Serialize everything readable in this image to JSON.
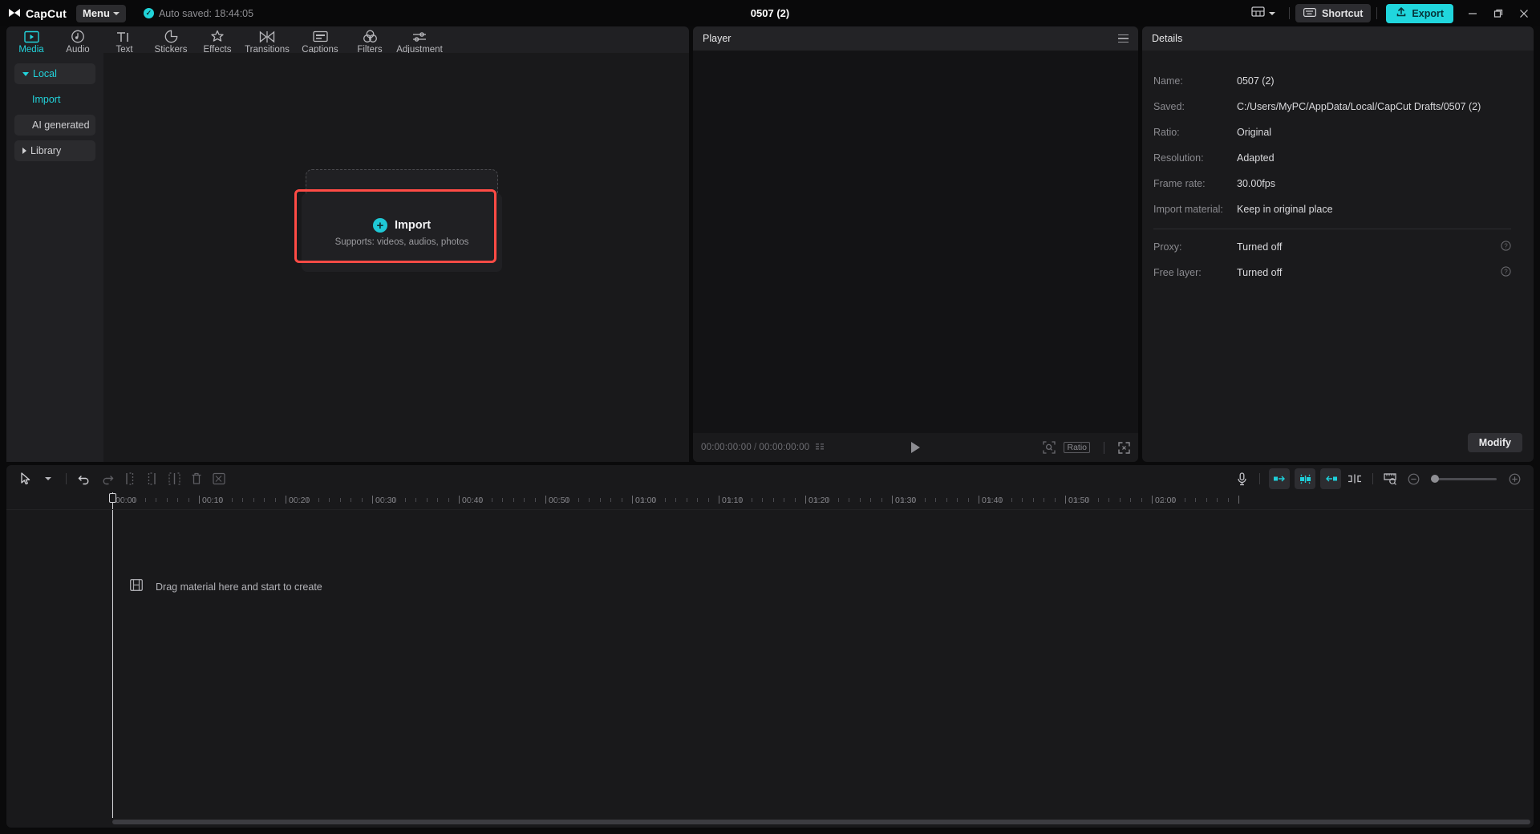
{
  "titlebar": {
    "brand": "CapCut",
    "menu_label": "Menu",
    "autosave_text": "Auto saved: 18:44:05",
    "project_title": "0507 (2)",
    "shortcut_label": "Shortcut",
    "export_label": "Export",
    "layout_icon": "layout-grid-icon",
    "minimize_icon": "minimize-icon",
    "maximize_icon": "maximize-icon",
    "close_icon": "close-icon"
  },
  "tabs": [
    {
      "label": "Media",
      "icon": "media-play-icon",
      "active": true
    },
    {
      "label": "Audio",
      "icon": "audio-note-icon",
      "active": false
    },
    {
      "label": "Text",
      "icon": "text-ti-icon",
      "active": false
    },
    {
      "label": "Stickers",
      "icon": "sticker-icon",
      "active": false
    },
    {
      "label": "Effects",
      "icon": "effects-sparkle-icon",
      "active": false
    },
    {
      "label": "Transitions",
      "icon": "transitions-icon",
      "active": false
    },
    {
      "label": "Captions",
      "icon": "captions-icon",
      "active": false
    },
    {
      "label": "Filters",
      "icon": "filters-circles-icon",
      "active": false
    },
    {
      "label": "Adjustment",
      "icon": "adjustment-sliders-icon",
      "active": false
    }
  ],
  "sidebar": {
    "items": [
      {
        "label": "Local",
        "style": "chip-teal-expanded"
      },
      {
        "label": "Import",
        "style": "sub-teal"
      },
      {
        "label": "AI generated",
        "style": "chip"
      },
      {
        "label": "Library",
        "style": "chip-collapsed"
      }
    ]
  },
  "media": {
    "import_label": "Import",
    "import_sub": "Supports: videos, audios, photos",
    "plus_icon": "plus-circle-icon",
    "highlight_color": "#ff4b45"
  },
  "player": {
    "title": "Player",
    "menu_icon": "hamburger-icon",
    "current_time": "00:00:00:00",
    "total_time": "00:00:00:00",
    "separator": "/",
    "play_icon": "play-icon",
    "frames_icon": "frames-icon",
    "crop_icon": "crop-zoom-icon",
    "ratio_label": "Ratio",
    "fullscreen_icon": "fullscreen-icon"
  },
  "details": {
    "title": "Details",
    "rows": [
      {
        "label": "Name:",
        "value": "0507 (2)",
        "help": false
      },
      {
        "label": "Saved:",
        "value": "C:/Users/MyPC/AppData/Local/CapCut Drafts/0507 (2)",
        "help": false
      },
      {
        "label": "Ratio:",
        "value": "Original",
        "help": false
      },
      {
        "label": "Resolution:",
        "value": "Adapted",
        "help": false
      },
      {
        "label": "Frame rate:",
        "value": "30.00fps",
        "help": false
      },
      {
        "label": "Import material:",
        "value": "Keep in original place",
        "help": false
      }
    ],
    "rows2": [
      {
        "label": "Proxy:",
        "value": "Turned off",
        "help": true
      },
      {
        "label": "Free layer:",
        "value": "Turned off",
        "help": true
      }
    ],
    "modify_label": "Modify"
  },
  "timeline": {
    "tools_left": [
      "select-cursor-icon",
      "cursor-dropdown-icon",
      "undo-icon",
      "redo-icon",
      "split-left-icon",
      "split-right-icon",
      "split-icon",
      "delete-icon",
      "mask-crop-icon"
    ],
    "tools_right": [
      "microphone-icon",
      "snap-left-icon",
      "auto-snap-icon",
      "snap-right-icon",
      "mirror-split-icon",
      "ruler-zoom-icon",
      "zoom-out-icon",
      "zoom-in-icon"
    ],
    "ruler_labels": [
      "00:00",
      "00:10",
      "00:20",
      "00:30",
      "00:40",
      "00:50",
      "01:00",
      "01:10",
      "01:20",
      "01:30",
      "01:40",
      "01:50",
      "02:00"
    ],
    "drag_hint": "Drag material here and start to create",
    "drag_icon": "film-strip-icon",
    "playhead_time": "00:00",
    "zoom_level": 0
  }
}
